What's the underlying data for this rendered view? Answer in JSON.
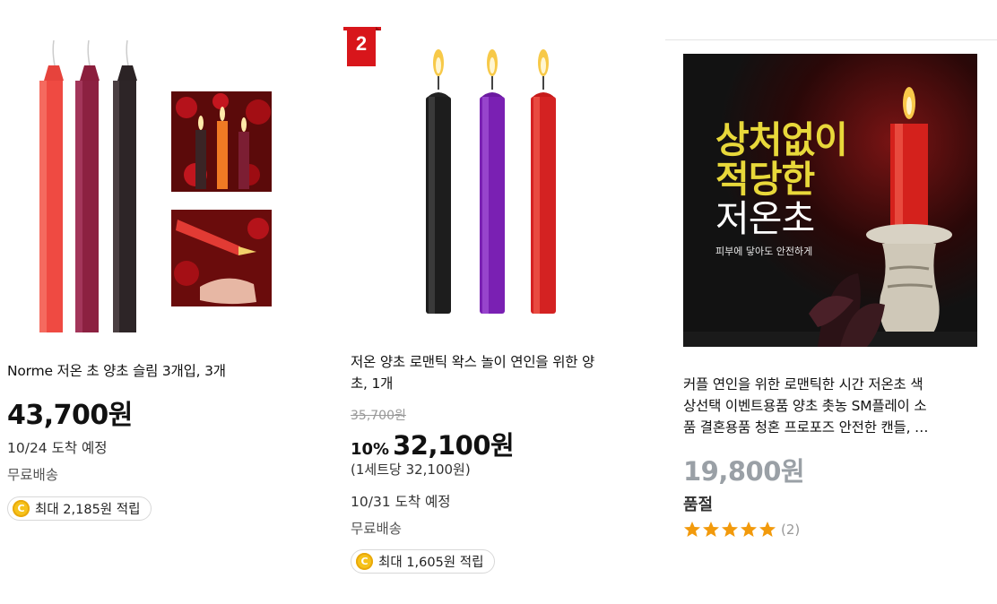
{
  "products": [
    {
      "title": "Norme 저온 초 양초 슬림 3개입, 3개",
      "price": "43,700원",
      "delivery": "10/24 도착 예정",
      "shipping": "무료배송",
      "reward": "최대 2,185원 적립",
      "reward_icon": "coin-icon"
    },
    {
      "rank": "2",
      "title_line1": "저온 양초 로맨틱 왁스 놀이 연인을 위한 양",
      "title_line2": "초, 1개",
      "original_price": "35,700원",
      "discount": "10%",
      "price": "32,100원",
      "unit_price": "(1세트당 32,100원)",
      "delivery": "10/31 도착 예정",
      "shipping": "무료배송",
      "reward": "최대 1,605원 적립",
      "reward_icon": "coin-icon"
    },
    {
      "title_line1": "커플 연인을 위한 로맨틱한 시간 저온초 색",
      "title_line2": "상선택 이벤트용품 양초 촛농 SM플레이 소",
      "title_line3": "품 결혼용품 청혼 프로포즈 안전한 캔들, …",
      "price": "19,800원",
      "status": "품절",
      "rating_stars": 5,
      "review_count": "(2)",
      "image_text": {
        "line1": "상처없이",
        "line2": "적당한",
        "line3": "저온초",
        "sub": "피부에 닿아도 안전하게"
      }
    }
  ],
  "colors": {
    "rank_badge": "#d8161b",
    "star": "#f29a0c",
    "coin": "#f6c21a",
    "muted_price": "#9aa0a6"
  }
}
